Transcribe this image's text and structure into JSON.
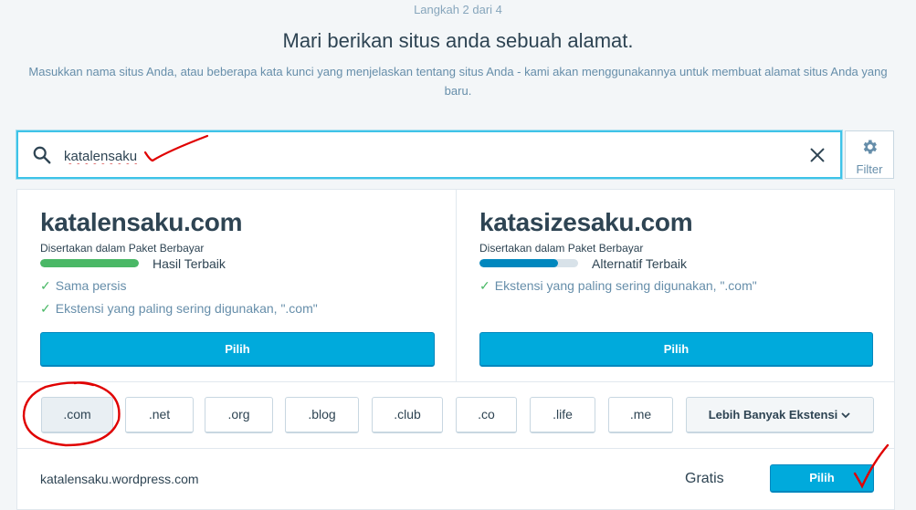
{
  "header": {
    "step": "Langkah 2 dari 4",
    "title": "Mari berikan situs anda sebuah alamat.",
    "subtitle": "Masukkan nama situs Anda, atau beberapa kata kunci yang menjelaskan tentang situs Anda - kami akan menggunakannya untuk membuat alamat situs Anda yang baru."
  },
  "search": {
    "value": "katalensaku",
    "icon": "search-icon",
    "clear_icon": "close-icon"
  },
  "filter": {
    "label": "Filter",
    "icon": "gear-icon"
  },
  "suggestions": [
    {
      "domain": "katalensaku.com",
      "included": "Disertakan dalam Paket Berbayar",
      "badge": "Hasil Terbaik",
      "match_level": 1.0,
      "bar_color": "#4ab866",
      "features": [
        "Sama persis",
        "Ekstensi yang paling sering digunakan, \".com\""
      ],
      "button": "Pilih"
    },
    {
      "domain": "katasizesaku.com",
      "included": "Disertakan dalam Paket Berbayar",
      "badge": "Alternatif Terbaik",
      "match_level": 0.8,
      "bar_color": "#0087be",
      "features": [
        "Ekstensi yang paling sering digunakan, \".com\""
      ],
      "button": "Pilih"
    }
  ],
  "tlds": [
    ".com",
    ".net",
    ".org",
    ".blog",
    ".club",
    ".co",
    ".life",
    ".me"
  ],
  "more_extensions": "Lebih Banyak Ekstensi",
  "free": {
    "domain": "katalensaku.wordpress.com",
    "price": "Gratis",
    "button": "Pilih"
  },
  "colors": {
    "accent": "#00aadc",
    "success": "#4ab866",
    "annotation": "#e00000"
  }
}
